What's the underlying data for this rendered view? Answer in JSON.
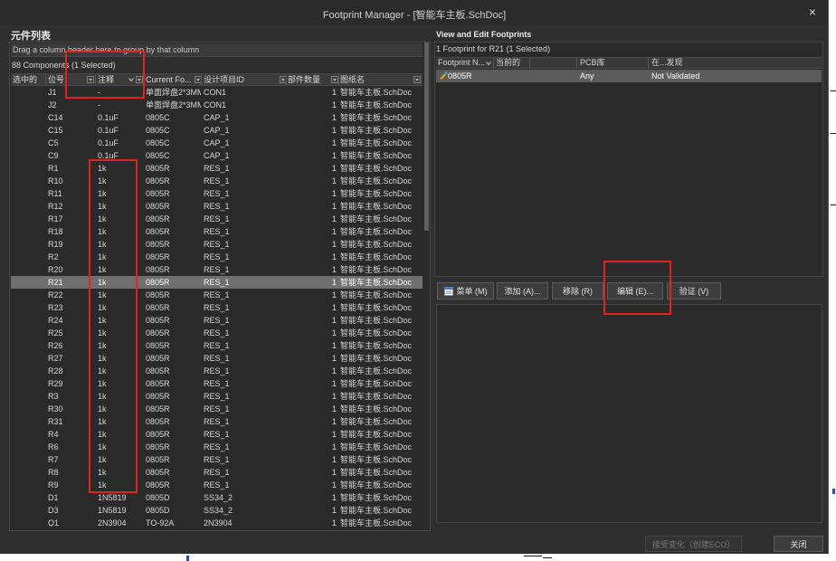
{
  "window": {
    "title": "Footprint Manager - [智能车主板.SchDoc]",
    "close_label": "×"
  },
  "components_panel": {
    "title": "元件列表",
    "group_hint": "Drag a column header here to group by that column",
    "count_text": "88 Components (1 Selected)",
    "columns": [
      "选中的",
      "位号",
      "注释",
      "Current Fo...",
      "设计项目ID",
      "部件数量",
      "图纸名"
    ],
    "rows": [
      {
        "designator": "J1",
        "comment": "-",
        "footprint": "单面焊盘2*3MM",
        "design_id": "CON1",
        "parts": "1",
        "sheet": "智能车主板.SchDoc"
      },
      {
        "designator": "J2",
        "comment": "-",
        "footprint": "单面焊盘2*3MM",
        "design_id": "CON1",
        "parts": "1",
        "sheet": "智能车主板.SchDoc"
      },
      {
        "designator": "C14",
        "comment": "0.1uF",
        "footprint": "0805C",
        "design_id": "CAP_1",
        "parts": "1",
        "sheet": "智能车主板.SchDoc"
      },
      {
        "designator": "C15",
        "comment": "0.1uF",
        "footprint": "0805C",
        "design_id": "CAP_1",
        "parts": "1",
        "sheet": "智能车主板.SchDoc"
      },
      {
        "designator": "C5",
        "comment": "0.1uF",
        "footprint": "0805C",
        "design_id": "CAP_1",
        "parts": "1",
        "sheet": "智能车主板.SchDoc"
      },
      {
        "designator": "C9",
        "comment": "0.1uF",
        "footprint": "0805C",
        "design_id": "CAP_1",
        "parts": "1",
        "sheet": "智能车主板.SchDoc"
      },
      {
        "designator": "R1",
        "comment": "1k",
        "footprint": "0805R",
        "design_id": "RES_1",
        "parts": "1",
        "sheet": "智能车主板.SchDoc"
      },
      {
        "designator": "R10",
        "comment": "1k",
        "footprint": "0805R",
        "design_id": "RES_1",
        "parts": "1",
        "sheet": "智能车主板.SchDoc"
      },
      {
        "designator": "R11",
        "comment": "1k",
        "footprint": "0805R",
        "design_id": "RES_1",
        "parts": "1",
        "sheet": "智能车主板.SchDoc"
      },
      {
        "designator": "R12",
        "comment": "1k",
        "footprint": "0805R",
        "design_id": "RES_1",
        "parts": "1",
        "sheet": "智能车主板.SchDoc"
      },
      {
        "designator": "R17",
        "comment": "1k",
        "footprint": "0805R",
        "design_id": "RES_1",
        "parts": "1",
        "sheet": "智能车主板.SchDoc"
      },
      {
        "designator": "R18",
        "comment": "1k",
        "footprint": "0805R",
        "design_id": "RES_1",
        "parts": "1",
        "sheet": "智能车主板.SchDoc"
      },
      {
        "designator": "R19",
        "comment": "1k",
        "footprint": "0805R",
        "design_id": "RES_1",
        "parts": "1",
        "sheet": "智能车主板.SchDoc"
      },
      {
        "designator": "R2",
        "comment": "1k",
        "footprint": "0805R",
        "design_id": "RES_1",
        "parts": "1",
        "sheet": "智能车主板.SchDoc"
      },
      {
        "designator": "R20",
        "comment": "1k",
        "footprint": "0805R",
        "design_id": "RES_1",
        "parts": "1",
        "sheet": "智能车主板.SchDoc"
      },
      {
        "designator": "R21",
        "comment": "1k",
        "footprint": "0805R",
        "design_id": "RES_1",
        "parts": "1",
        "sheet": "智能车主板.SchDoc",
        "is_selected": true
      },
      {
        "designator": "R22",
        "comment": "1k",
        "footprint": "0805R",
        "design_id": "RES_1",
        "parts": "1",
        "sheet": "智能车主板.SchDoc"
      },
      {
        "designator": "R23",
        "comment": "1k",
        "footprint": "0805R",
        "design_id": "RES_1",
        "parts": "1",
        "sheet": "智能车主板.SchDoc"
      },
      {
        "designator": "R24",
        "comment": "1k",
        "footprint": "0805R",
        "design_id": "RES_1",
        "parts": "1",
        "sheet": "智能车主板.SchDoc"
      },
      {
        "designator": "R25",
        "comment": "1k",
        "footprint": "0805R",
        "design_id": "RES_1",
        "parts": "1",
        "sheet": "智能车主板.SchDoc"
      },
      {
        "designator": "R26",
        "comment": "1k",
        "footprint": "0805R",
        "design_id": "RES_1",
        "parts": "1",
        "sheet": "智能车主板.SchDoc"
      },
      {
        "designator": "R27",
        "comment": "1k",
        "footprint": "0805R",
        "design_id": "RES_1",
        "parts": "1",
        "sheet": "智能车主板.SchDoc"
      },
      {
        "designator": "R28",
        "comment": "1k",
        "footprint": "0805R",
        "design_id": "RES_1",
        "parts": "1",
        "sheet": "智能车主板.SchDoc"
      },
      {
        "designator": "R29",
        "comment": "1k",
        "footprint": "0805R",
        "design_id": "RES_1",
        "parts": "1",
        "sheet": "智能车主板.SchDoc"
      },
      {
        "designator": "R3",
        "comment": "1k",
        "footprint": "0805R",
        "design_id": "RES_1",
        "parts": "1",
        "sheet": "智能车主板.SchDoc"
      },
      {
        "designator": "R30",
        "comment": "1k",
        "footprint": "0805R",
        "design_id": "RES_1",
        "parts": "1",
        "sheet": "智能车主板.SchDoc"
      },
      {
        "designator": "R31",
        "comment": "1k",
        "footprint": "0805R",
        "design_id": "RES_1",
        "parts": "1",
        "sheet": "智能车主板.SchDoc"
      },
      {
        "designator": "R4",
        "comment": "1k",
        "footprint": "0805R",
        "design_id": "RES_1",
        "parts": "1",
        "sheet": "智能车主板.SchDoc"
      },
      {
        "designator": "R6",
        "comment": "1k",
        "footprint": "0805R",
        "design_id": "RES_1",
        "parts": "1",
        "sheet": "智能车主板.SchDoc"
      },
      {
        "designator": "R7",
        "comment": "1k",
        "footprint": "0805R",
        "design_id": "RES_1",
        "parts": "1",
        "sheet": "智能车主板.SchDoc"
      },
      {
        "designator": "R8",
        "comment": "1k",
        "footprint": "0805R",
        "design_id": "RES_1",
        "parts": "1",
        "sheet": "智能车主板.SchDoc"
      },
      {
        "designator": "R9",
        "comment": "1k",
        "footprint": "0805R",
        "design_id": "RES_1",
        "parts": "1",
        "sheet": "智能车主板.SchDoc"
      },
      {
        "designator": "D1",
        "comment": "1N5819",
        "footprint": "0805D",
        "design_id": "SS34_2",
        "parts": "1",
        "sheet": "智能车主板.SchDoc"
      },
      {
        "designator": "D3",
        "comment": "1N5819",
        "footprint": "0805D",
        "design_id": "SS34_2",
        "parts": "1",
        "sheet": "智能车主板.SchDoc"
      },
      {
        "designator": "Q1",
        "comment": "2N3904",
        "footprint": "TO-92A",
        "design_id": "2N3904",
        "parts": "1",
        "sheet": "智能车主板.SchDoc"
      }
    ]
  },
  "footprints_panel": {
    "title": "View and Edit Footprints",
    "count_text": "1 Footprint for R21 (1 Selected)",
    "columns": [
      "Footprint N...",
      "当前的",
      "PCB库",
      "在...发现"
    ],
    "rows": [
      {
        "name": "0805R",
        "pcb_library": "Any",
        "found_in": "Not Validated",
        "is_selected": true
      }
    ],
    "buttons": {
      "menu": "菜单 (M)",
      "add": "添加 (A)...",
      "remove": "移除 (R)",
      "edit": "编辑 (E)...",
      "validate": "验证 (V)"
    }
  },
  "footer": {
    "accept_label": "接受变化（创建ECO）",
    "accept_enabled": false,
    "close_label": "关闭"
  },
  "icons": {
    "close": "close-icon",
    "column_filter": "filter-icon",
    "sort": "sort-chevron-icon",
    "footprint": "footprint-icon",
    "menu": "menu-icon"
  },
  "colors": {
    "title_bar": "#2b2b2b",
    "dialog_background": "#2f2f2f",
    "grid_background": "#2a2a2a",
    "selected_row": "#6f6f6f",
    "annotation_red": "#e5231d"
  }
}
